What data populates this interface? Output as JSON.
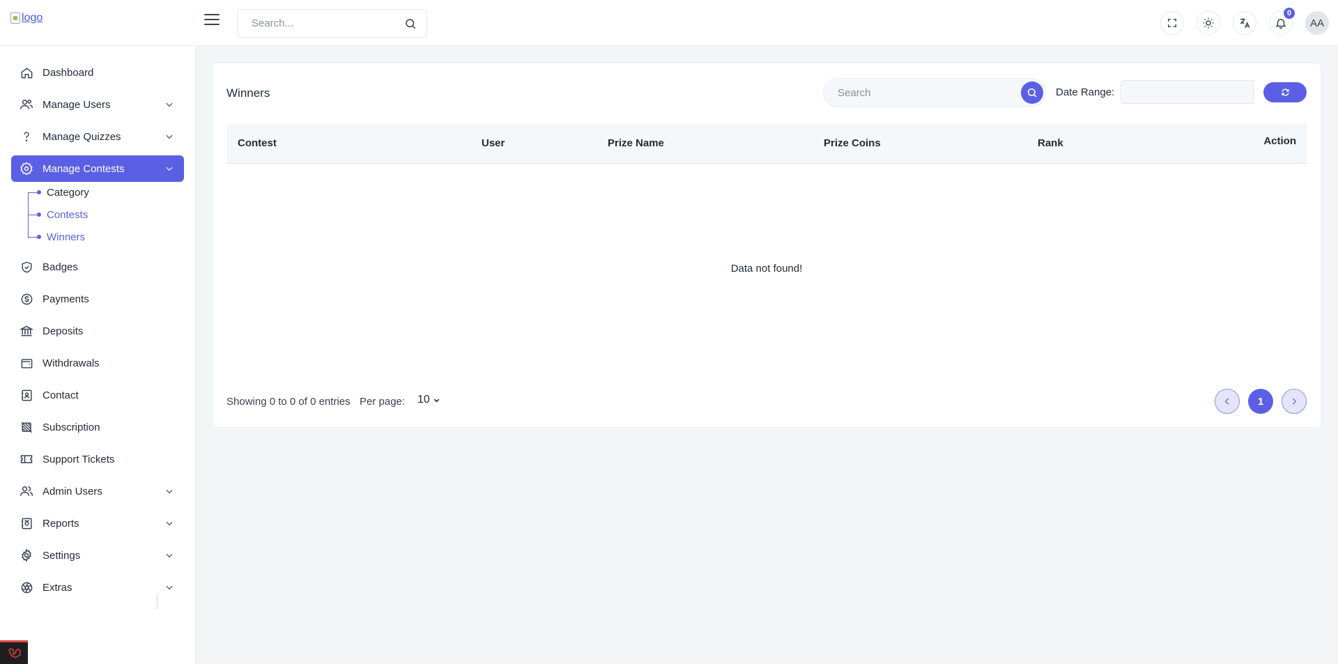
{
  "header": {
    "logo_alt": "logo",
    "search_placeholder": "Search...",
    "notification_count": "0",
    "avatar_initials": "AA"
  },
  "sidebar": {
    "items": [
      {
        "label": "Dashboard",
        "icon": "home-icon"
      },
      {
        "label": "Manage Users",
        "icon": "users-icon"
      },
      {
        "label": "Manage Quizzes",
        "icon": "question-icon"
      },
      {
        "label": "Manage Contests",
        "icon": "badge-gear-icon"
      },
      {
        "label": "Badges",
        "icon": "shield-check-icon"
      },
      {
        "label": "Payments",
        "icon": "dollar-coin-icon"
      },
      {
        "label": "Deposits",
        "icon": "bank-icon"
      },
      {
        "label": "Withdrawals",
        "icon": "wallet-icon"
      },
      {
        "label": "Contact",
        "icon": "contact-book-icon"
      },
      {
        "label": "Subscription",
        "icon": "subscription-icon"
      },
      {
        "label": "Support Tickets",
        "icon": "ticket-icon"
      },
      {
        "label": "Admin Users",
        "icon": "admin-users-icon"
      },
      {
        "label": "Reports",
        "icon": "report-icon"
      },
      {
        "label": "Settings",
        "icon": "gear-icon"
      },
      {
        "label": "Extras",
        "icon": "aperture-icon"
      }
    ],
    "contest_sub": [
      {
        "label": "Category"
      },
      {
        "label": "Contests"
      },
      {
        "label": "Winners"
      }
    ]
  },
  "main": {
    "title": "Winners",
    "search_placeholder": "Search",
    "date_range_label": "Date Range:",
    "columns": [
      "Contest",
      "User",
      "Prize Name",
      "Prize Coins",
      "Rank",
      "Action"
    ],
    "empty_message": "Data not found!",
    "showing": "Showing 0 to 0 of 0 entries",
    "per_page_label": "Per page:",
    "per_page_value": "10",
    "current_page": "1"
  },
  "colors": {
    "accent": "#5b5fe3"
  }
}
